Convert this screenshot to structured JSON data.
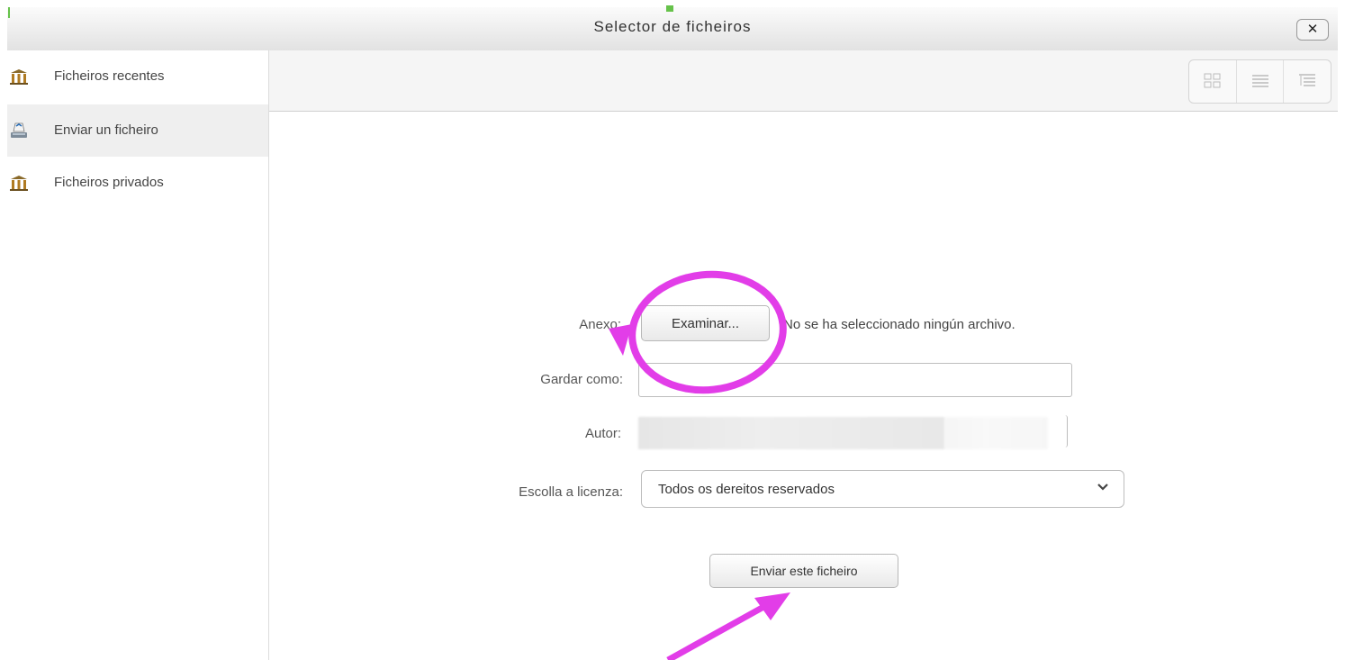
{
  "window": {
    "title": "Selector de ficheiros",
    "close_label": "✕"
  },
  "sidebar": {
    "items": [
      {
        "label": "Ficheiros recentes",
        "icon": "repository-icon",
        "active": false
      },
      {
        "label": "Enviar un ficheiro",
        "icon": "upload-icon",
        "active": true
      },
      {
        "label": "Ficheiros privados",
        "icon": "repository-icon",
        "active": false
      }
    ]
  },
  "toolbar": {
    "views": [
      "grid-view-icon",
      "list-view-icon",
      "tree-view-icon"
    ]
  },
  "form": {
    "attachment_label": "Anexo:",
    "browse_button": "Examinar...",
    "no_file_text": "No se ha seleccionado ningún archivo.",
    "save_as_label": "Gardar como:",
    "save_as_value": "",
    "author_label": "Autor:",
    "license_label": "Escolla a licenza:",
    "license_value": "Todos os dereitos reservados",
    "submit_button": "Enviar este ficheiro"
  },
  "annotations": {
    "color": "#e23de8"
  }
}
